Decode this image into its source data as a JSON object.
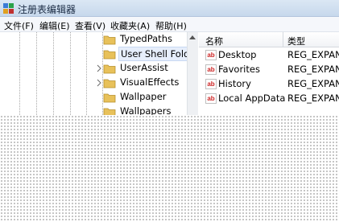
{
  "window": {
    "title": "注册表编辑器",
    "icon": "registry-editor-icon"
  },
  "menu": {
    "items": [
      "文件(F)",
      "编辑(E)",
      "查看(V)",
      "收藏夹(A)",
      "帮助(H)"
    ]
  },
  "tree": {
    "items": [
      {
        "label": "TypedPaths",
        "has_children": false,
        "selected": false
      },
      {
        "label": "User Shell Folders",
        "has_children": false,
        "selected": true
      },
      {
        "label": "UserAssist",
        "has_children": true,
        "selected": false
      },
      {
        "label": "VisualEffects",
        "has_children": true,
        "selected": false
      },
      {
        "label": "Wallpaper",
        "has_children": false,
        "selected": false
      },
      {
        "label": "Wallpapers",
        "has_children": false,
        "selected": false
      }
    ]
  },
  "list": {
    "columns": [
      "名称",
      "类型"
    ],
    "rows": [
      {
        "name": "Desktop",
        "type": "REG_EXPAND_SZ",
        "icon": "string-value-icon"
      },
      {
        "name": "Favorites",
        "type": "REG_EXPAND_SZ",
        "icon": "string-value-icon"
      },
      {
        "name": "History",
        "type": "REG_EXPAND_SZ",
        "icon": "string-value-icon"
      },
      {
        "name": "Local AppData",
        "type": "REG_EXPAND_SZ",
        "icon": "string-value-icon"
      }
    ]
  },
  "colors": {
    "folder": "#e8c15a",
    "selection": "#e6eefb",
    "value_icon_text": "#cc2222"
  }
}
